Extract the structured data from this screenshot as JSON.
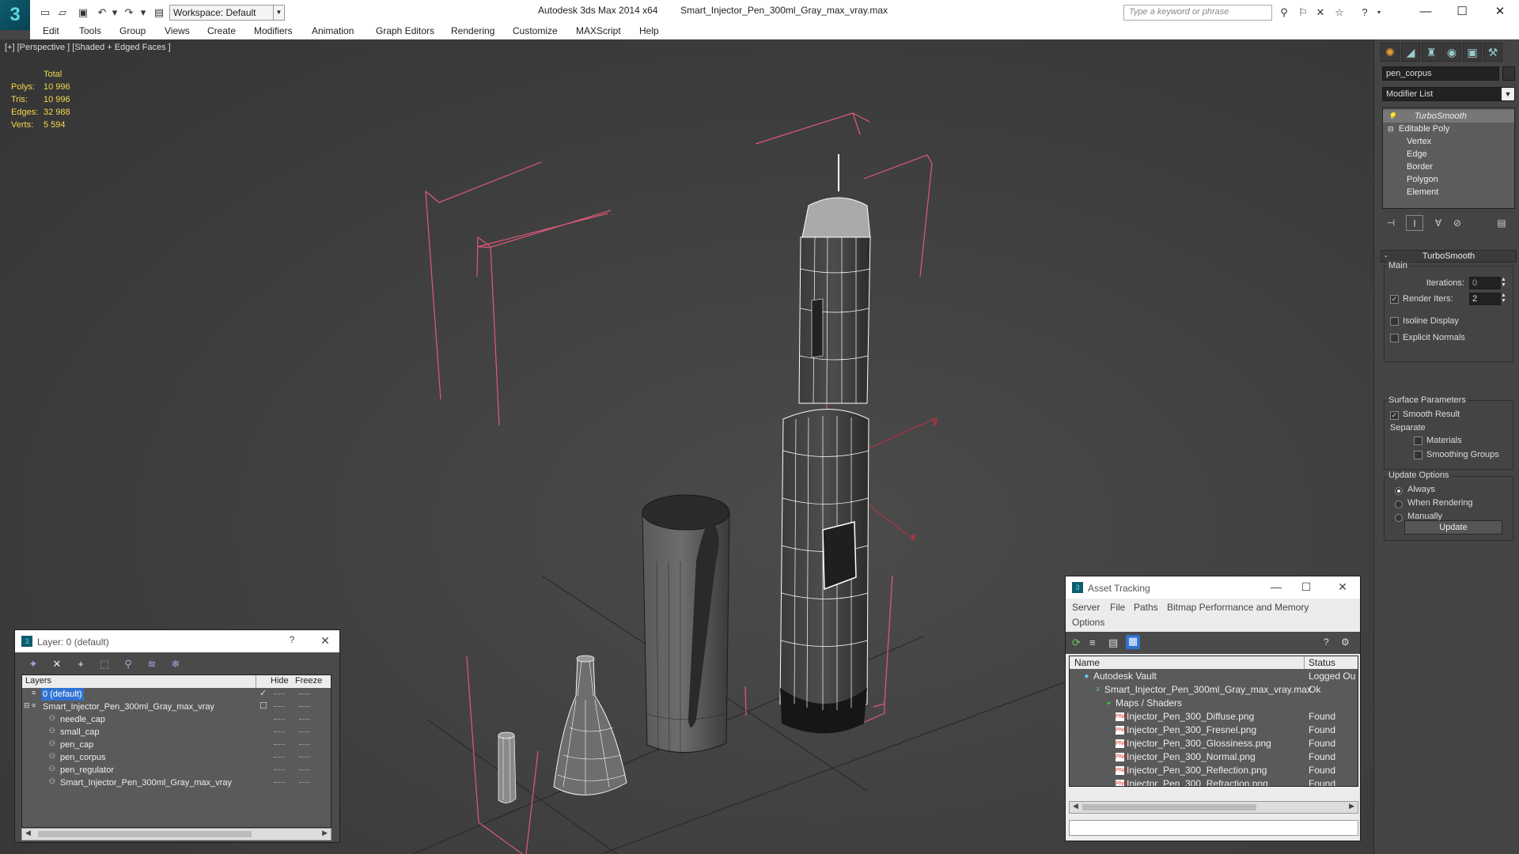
{
  "titlebar": {
    "app_logo": "3",
    "workspace_label": "Workspace: Default",
    "app_title": "Autodesk 3ds Max  2014 x64",
    "file_title": "Smart_Injector_Pen_300ml_Gray_max_vray.max",
    "search_placeholder": "Type a keyword or phrase"
  },
  "menu": [
    "Edit",
    "Tools",
    "Group",
    "Views",
    "Create",
    "Modifiers",
    "Animation",
    "Graph Editors",
    "Rendering",
    "Customize",
    "MAXScript",
    "Help"
  ],
  "viewport": {
    "label": "[+] [Perspective ] [Shaded + Edged Faces ]",
    "stats_header": "Total",
    "stats": [
      {
        "key": "Polys:",
        "value": "10 996"
      },
      {
        "key": "Tris:",
        "value": "10 996"
      },
      {
        "key": "Edges:",
        "value": "32 988"
      },
      {
        "key": "Verts:",
        "value": "5 594"
      }
    ],
    "colors": {
      "stats": "#f4d94f",
      "bracket": "#e05a7a"
    }
  },
  "command_panel": {
    "object_name": "pen_corpus",
    "modifier_list": "Modifier List",
    "stack": [
      "TurboSmooth",
      "Editable Poly",
      "Vertex",
      "Edge",
      "Border",
      "Polygon",
      "Element"
    ],
    "rollout_title": "TurboSmooth",
    "main_label": "Main",
    "iterations_label": "Iterations:",
    "iterations_value": "0",
    "render_iters_label": "Render Iters:",
    "render_iters_value": "2",
    "isoline_label": "Isoline Display",
    "explicit_normals_label": "Explicit Normals",
    "surface_params_label": "Surface Parameters",
    "smooth_result_label": "Smooth Result",
    "separate_label": "Separate",
    "materials_label": "Materials",
    "smoothing_groups_label": "Smoothing Groups",
    "update_options_label": "Update Options",
    "always_label": "Always",
    "when_rendering_label": "When Rendering",
    "manually_label": "Manually",
    "update_button": "Update"
  },
  "layer_dialog": {
    "title": "Layer: 0 (default)",
    "help": "?",
    "columns": [
      "Layers",
      "Hide",
      "Freeze"
    ],
    "rows": [
      {
        "name": "0 (default)",
        "indent": 0,
        "selected": true
      },
      {
        "name": "Smart_Injector_Pen_300ml_Gray_max_vray",
        "indent": 0,
        "selected": false
      },
      {
        "name": "needle_cap",
        "indent": 1,
        "selected": false
      },
      {
        "name": "small_cap",
        "indent": 1,
        "selected": false
      },
      {
        "name": "pen_cap",
        "indent": 1,
        "selected": false
      },
      {
        "name": "pen_corpus",
        "indent": 1,
        "selected": false
      },
      {
        "name": "pen_regulator",
        "indent": 1,
        "selected": false
      },
      {
        "name": "Smart_Injector_Pen_300ml_Gray_max_vray",
        "indent": 1,
        "selected": false
      }
    ]
  },
  "asset_tracking": {
    "title": "Asset Tracking",
    "menu": [
      "Server",
      "File",
      "Paths",
      "Bitmap Performance and Memory",
      "Options"
    ],
    "columns": [
      "Name",
      "Status"
    ],
    "rows": [
      {
        "name": "Autodesk Vault",
        "status": "Logged Ou",
        "level": 0,
        "icon": "vault"
      },
      {
        "name": "Smart_Injector_Pen_300ml_Gray_max_vray.max",
        "status": "Ok",
        "level": 1,
        "icon": "max"
      },
      {
        "name": "Maps / Shaders",
        "status": "",
        "level": 2,
        "icon": "folder"
      },
      {
        "name": "Injector_Pen_300_Diffuse.png",
        "status": "Found",
        "level": 3,
        "icon": "png"
      },
      {
        "name": "Injector_Pen_300_Fresnel.png",
        "status": "Found",
        "level": 3,
        "icon": "png"
      },
      {
        "name": "Injector_Pen_300_Glossiness.png",
        "status": "Found",
        "level": 3,
        "icon": "png"
      },
      {
        "name": "Injector_Pen_300_Normal.png",
        "status": "Found",
        "level": 3,
        "icon": "png"
      },
      {
        "name": "Injector_Pen_300_Reflection.png",
        "status": "Found",
        "level": 3,
        "icon": "png"
      },
      {
        "name": "Injector_Pen_300_Refraction.png",
        "status": "Found",
        "level": 3,
        "icon": "png"
      }
    ]
  }
}
